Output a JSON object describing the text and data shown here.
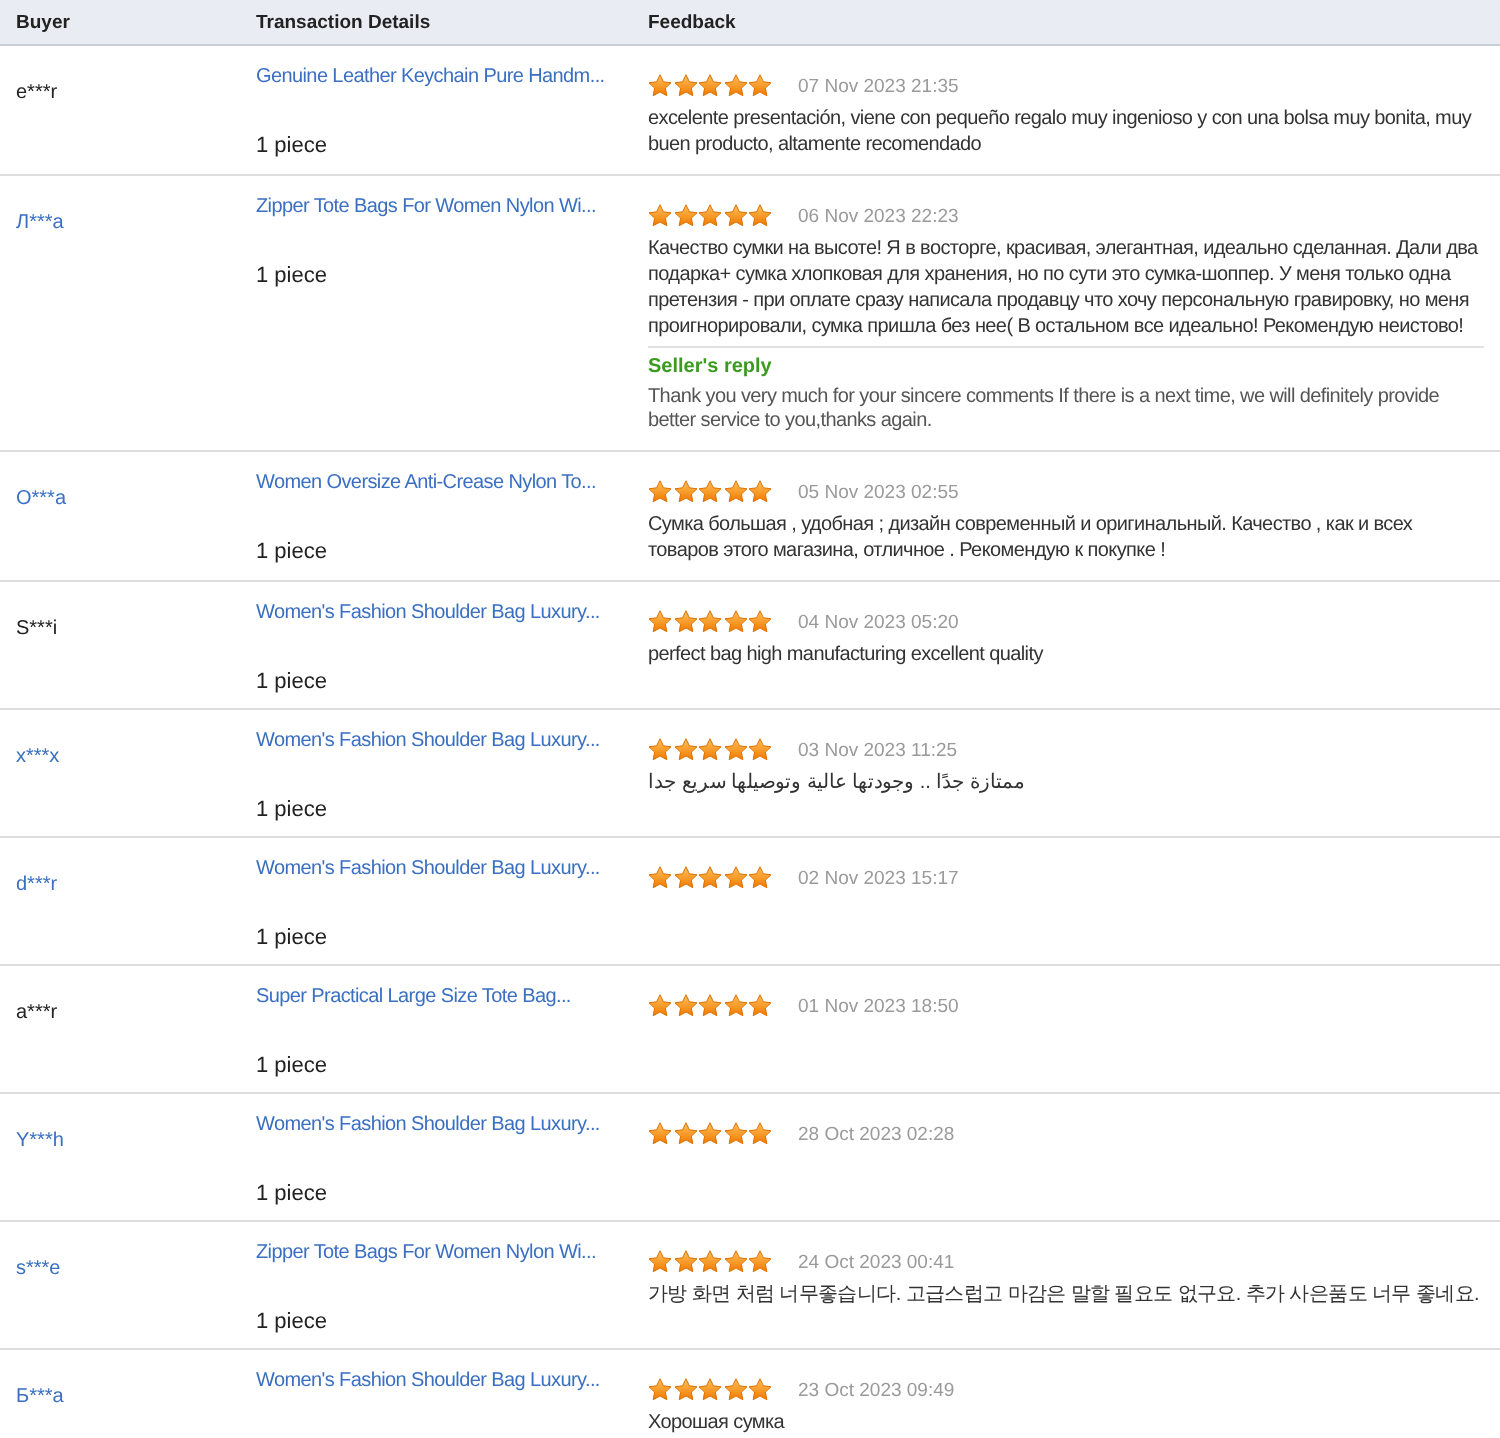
{
  "table": {
    "columns": [
      "Buyer",
      "Transaction Details",
      "Feedback"
    ],
    "rows": [
      {
        "buyer": {
          "name": "e***r",
          "link": false
        },
        "product": "Genuine Leather Keychain Pure Handm...",
        "quantity": "1 piece",
        "stars": 5,
        "date": "07 Nov 2023 21:35",
        "comment": "excelente presentación, viene con pequeño regalo muy ingenioso y con una bolsa muy bonita, muy buen producto, altamente recomendado"
      },
      {
        "buyer": {
          "name": "Л***a",
          "link": true
        },
        "product": "Zipper Tote Bags For Women Nylon Wi...",
        "quantity": "1 piece",
        "stars": 5,
        "date": "06 Nov 2023 22:23",
        "comment": "Качество сумки на высоте! Я в восторге, красивая, элегантная, идеально сделанная. Дали два подарка+ сумка хлопковая для хранения, но по сути это сумка-шоппер. У меня только одна претензия - при оплате сразу написала продавцу что хочу персональную гравировку, но меня проигнорировали, сумка пришла без нее( В остальном все идеально! Рекомендую неистово!",
        "seller_reply": {
          "label": "Seller's reply",
          "text": "Thank you very much for your sincere comments If there is a next time, we will definitely provide better service to you,thanks again."
        }
      },
      {
        "buyer": {
          "name": "O***a",
          "link": true
        },
        "product": "Women Oversize Anti-Crease Nylon To...",
        "quantity": "1 piece",
        "stars": 5,
        "date": "05 Nov 2023 02:55",
        "comment": "Сумка большая , удобная ; дизайн современный и оригинальный. Качество , как и всех товаров этого магазина, отличное . Рекомендую к покупке !"
      },
      {
        "buyer": {
          "name": "S***i",
          "link": false
        },
        "product": "Women's Fashion Shoulder Bag Luxury...",
        "quantity": "1 piece",
        "stars": 5,
        "date": "04 Nov 2023 05:20",
        "comment": "perfect bag high manufacturing excellent quality"
      },
      {
        "buyer": {
          "name": "x***x",
          "link": true
        },
        "product": "Women's Fashion Shoulder Bag Luxury...",
        "quantity": "1 piece",
        "stars": 5,
        "date": "03 Nov 2023 11:25",
        "comment": "ممتازة جدًا .. وجودتها عالية وتوصيلها سريع جدا"
      },
      {
        "buyer": {
          "name": "d***r",
          "link": true
        },
        "product": "Women's Fashion Shoulder Bag Luxury...",
        "quantity": "1 piece",
        "stars": 5,
        "date": "02 Nov 2023 15:17"
      },
      {
        "buyer": {
          "name": "a***r",
          "link": false
        },
        "product": "Super Practical Large Size Tote Bag...",
        "quantity": "1 piece",
        "stars": 5,
        "date": "01 Nov 2023 18:50"
      },
      {
        "buyer": {
          "name": "Y***h",
          "link": true
        },
        "product": "Women's Fashion Shoulder Bag Luxury...",
        "quantity": "1 piece",
        "stars": 5,
        "date": "28 Oct 2023 02:28"
      },
      {
        "buyer": {
          "name": "s***e",
          "link": true
        },
        "product": "Zipper Tote Bags For Women Nylon Wi...",
        "quantity": "1 piece",
        "stars": 5,
        "date": "24 Oct 2023 00:41",
        "comment": "가방 화면 처럼 너무좋습니다. 고급스럽고 마감은 말할 필요도 없구요. 추가 사은품도 너무 좋네요."
      },
      {
        "buyer": {
          "name": "Б***a",
          "link": true
        },
        "product": "Women's Fashion Shoulder Bag Luxury...",
        "stars": 5,
        "date": "23 Oct 2023 09:49",
        "comment": "Хорошая сумка"
      }
    ]
  }
}
